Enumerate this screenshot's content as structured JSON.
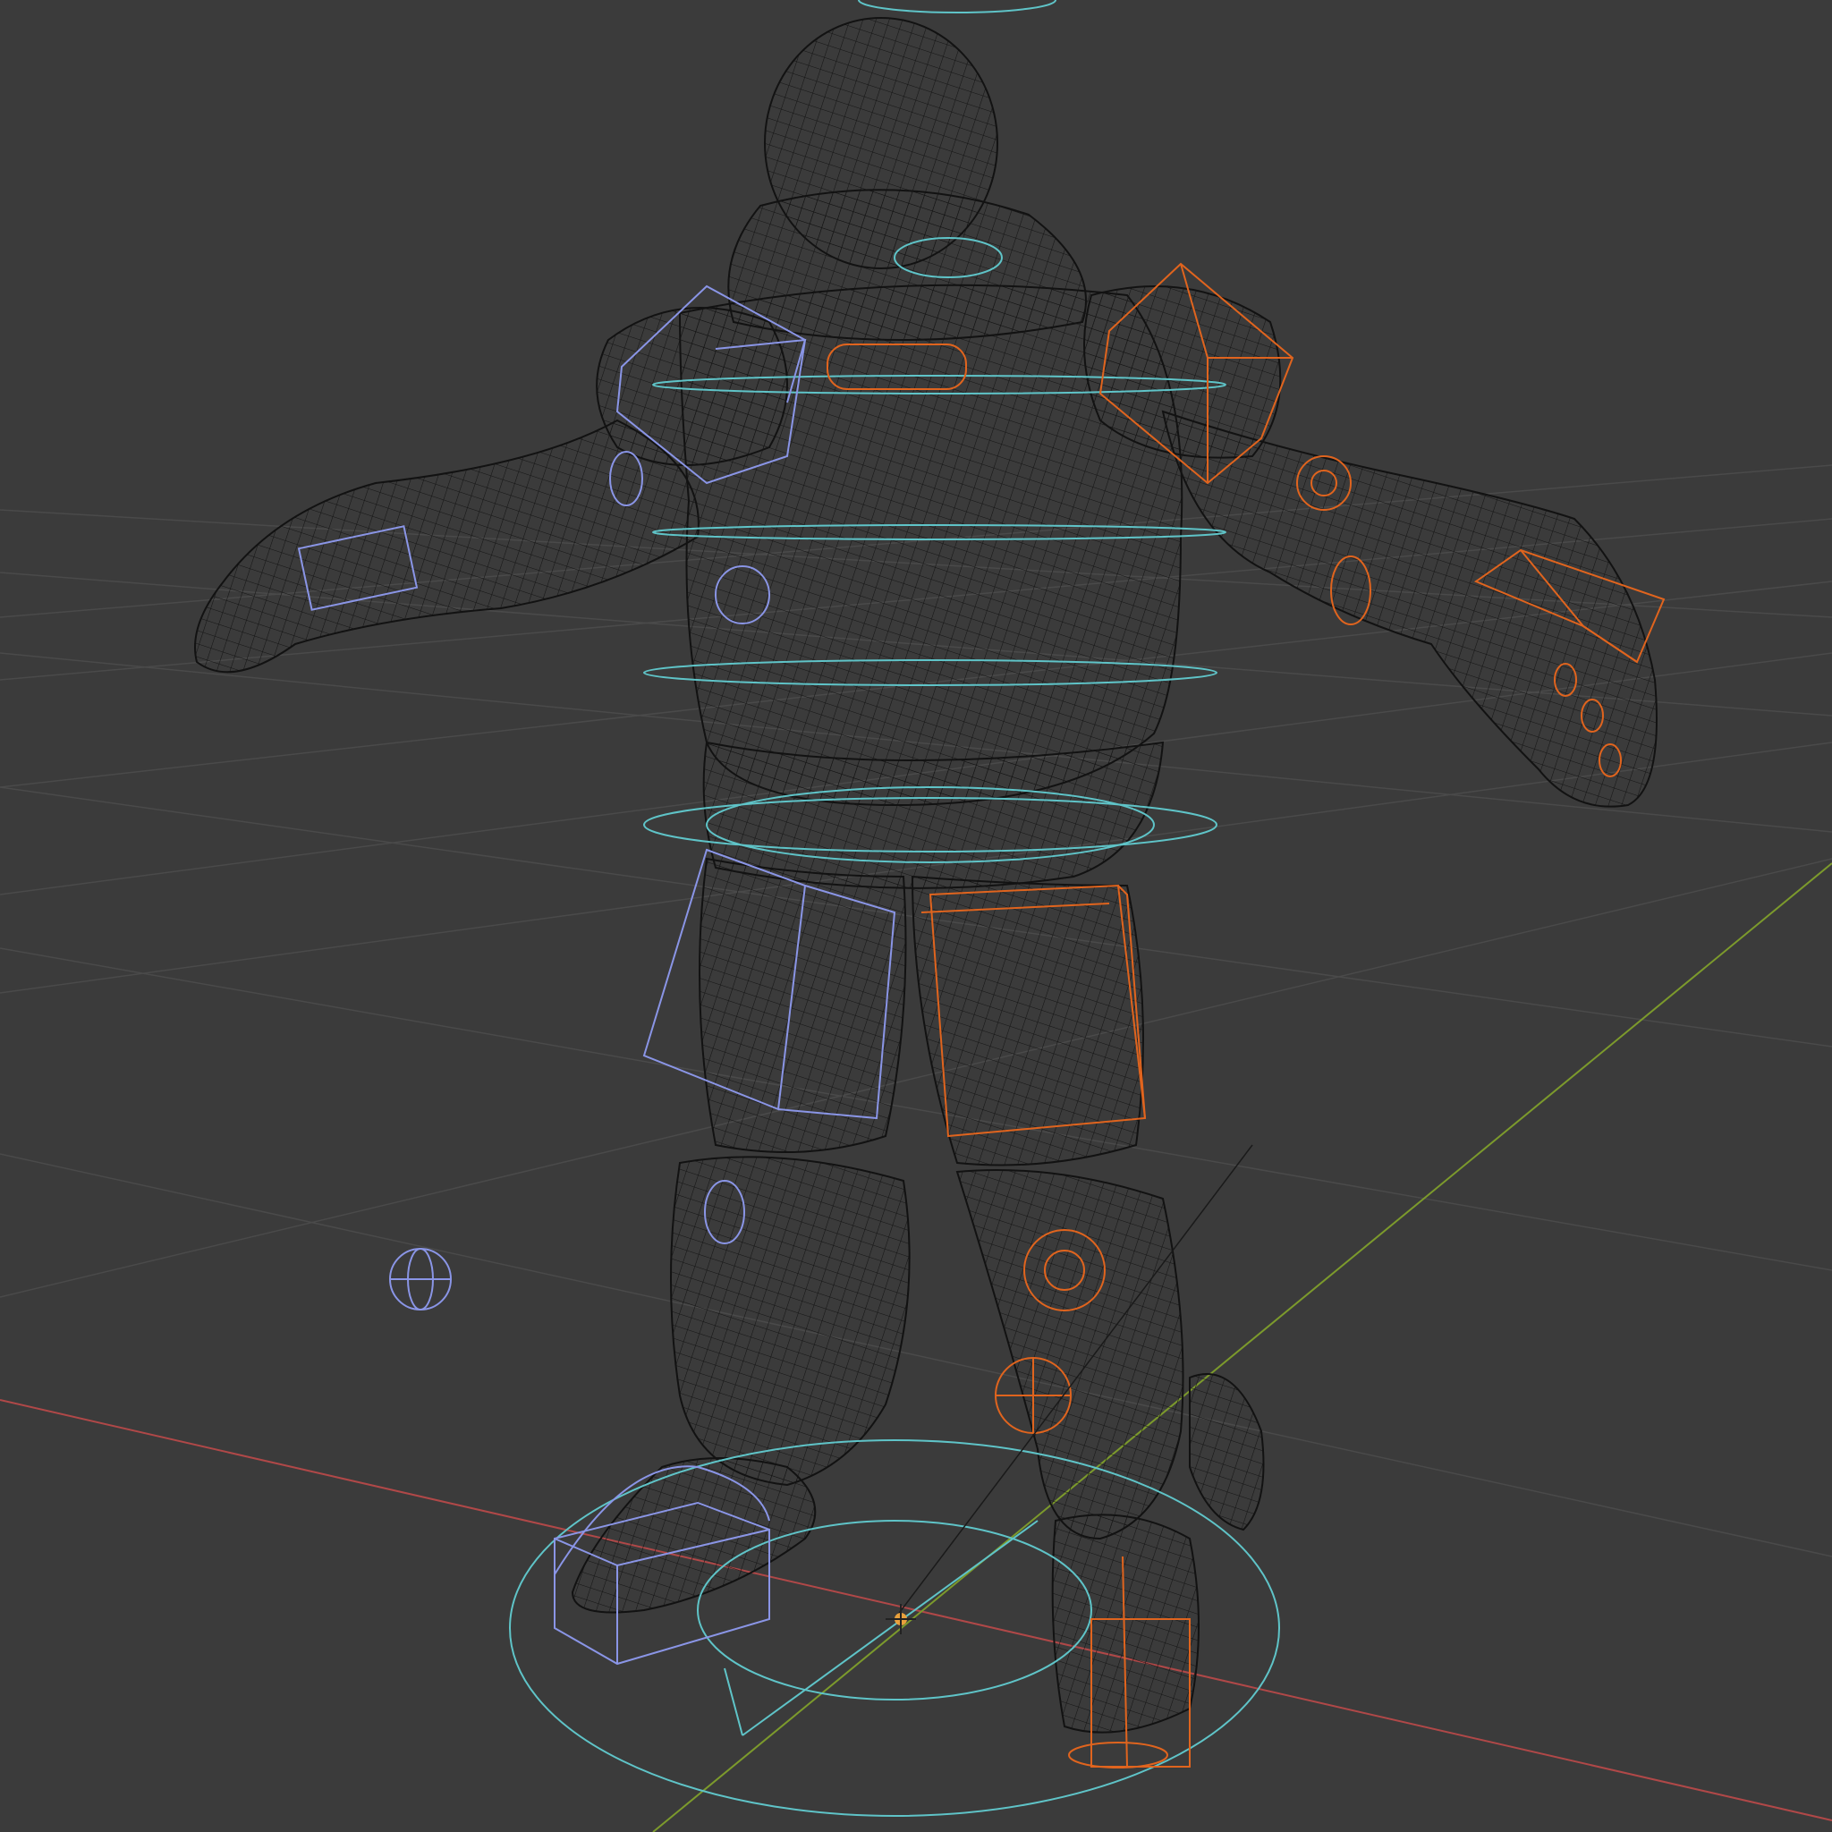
{
  "viewport": {
    "mode": "wireframe",
    "background": "#3b3b3b"
  },
  "colors": {
    "grid": "#4a4a4a",
    "axis_x": "#b04848",
    "axis_y": "#7c9a2c",
    "mesh": "#121212",
    "control_center": "#5fc4c8",
    "control_left": "#8a95e6",
    "control_right": "#e0641e",
    "origin": "#e8a03c"
  },
  "icons": {
    "origin": "origin-crosshair-icon",
    "pivot": "pivot-sphere-icon"
  }
}
